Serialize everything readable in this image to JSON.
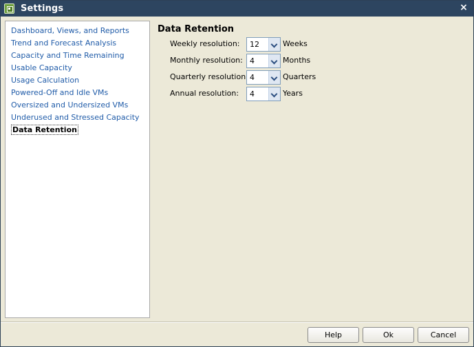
{
  "window": {
    "title": "Settings"
  },
  "icons": {
    "app": "settings-app-icon",
    "close": "close-icon",
    "dropdown": "chevron-down-icon"
  },
  "titlebar": {
    "close_glyph": "×"
  },
  "nav": {
    "items": [
      {
        "label": "Dashboard, Views, and Reports"
      },
      {
        "label": "Trend and Forecast Analysis"
      },
      {
        "label": "Capacity and Time Remaining"
      },
      {
        "label": "Usable Capacity"
      },
      {
        "label": "Usage Calculation"
      },
      {
        "label": "Powered-Off and Idle VMs"
      },
      {
        "label": "Oversized and Undersized VMs"
      },
      {
        "label": "Underused and Stressed Capacity"
      },
      {
        "label": "Data Retention"
      }
    ],
    "selected": "Data Retention"
  },
  "content": {
    "title": "Data Retention",
    "rows": [
      {
        "label": "Weekly resolution:",
        "value": "12",
        "unit": "Weeks"
      },
      {
        "label": "Monthly resolution:",
        "value": "4",
        "unit": "Months"
      },
      {
        "label": "Quarterly resolution:",
        "value": "4",
        "unit": "Quarters"
      },
      {
        "label": "Annual resolution:",
        "value": "4",
        "unit": "Years"
      }
    ]
  },
  "buttons": {
    "help": "Help",
    "ok": "Ok",
    "cancel": "Cancel"
  },
  "colors": {
    "titlebar": "#2d4560",
    "link": "#1f5ba8",
    "background": "#ece9d8",
    "combo_border": "#7f9db9"
  }
}
